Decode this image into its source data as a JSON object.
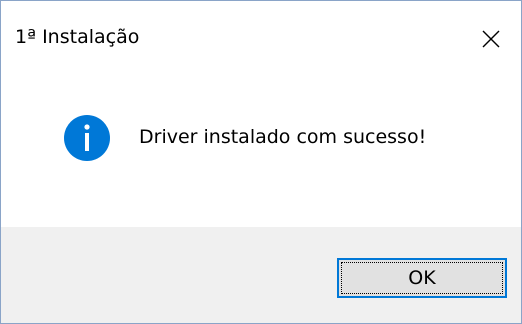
{
  "window": {
    "title": "1ª Instalação"
  },
  "dialog": {
    "icon": "info-icon",
    "message": "Driver instalado com sucesso!"
  },
  "buttons": {
    "ok_label": "OK"
  },
  "colors": {
    "accent": "#0078d7",
    "footer_bg": "#f0f0f0",
    "button_bg": "#e1e1e1",
    "window_border": "#8aa4c8"
  }
}
